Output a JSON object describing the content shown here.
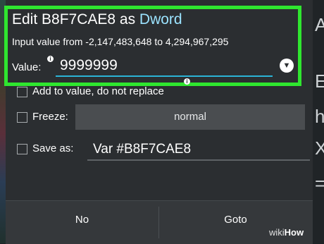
{
  "dialog": {
    "title_prefix": "Edit B8F7CAE8 as ",
    "title_type": "Dword",
    "range_text": "Input value from -2,147,483,648 to 4,294,967,295",
    "value_label": "Value:",
    "value_input": "9999999",
    "info_glyph": "i",
    "add_to_value_label": "Add to value, do not replace",
    "freeze_label": "Freeze:",
    "freeze_value": "normal",
    "save_as_label": "Save as:",
    "save_as_value": "Var #B8F7CAE8",
    "no_button": "No",
    "goto_button": "Goto"
  },
  "right_strip": {
    "chars": [
      "A",
      "E",
      "h",
      "X",
      "="
    ]
  },
  "watermark": {
    "brand_a": "wiki",
    "brand_b": "How"
  },
  "colors": {
    "highlight_border": "#2fe62f",
    "type_accent": "#9be3ff",
    "input_underline": "#2bb3d6",
    "dialog_bg": "#2b2e31"
  },
  "icons": {
    "dropdown": "chevron-down-icon",
    "info": "info-icon"
  }
}
